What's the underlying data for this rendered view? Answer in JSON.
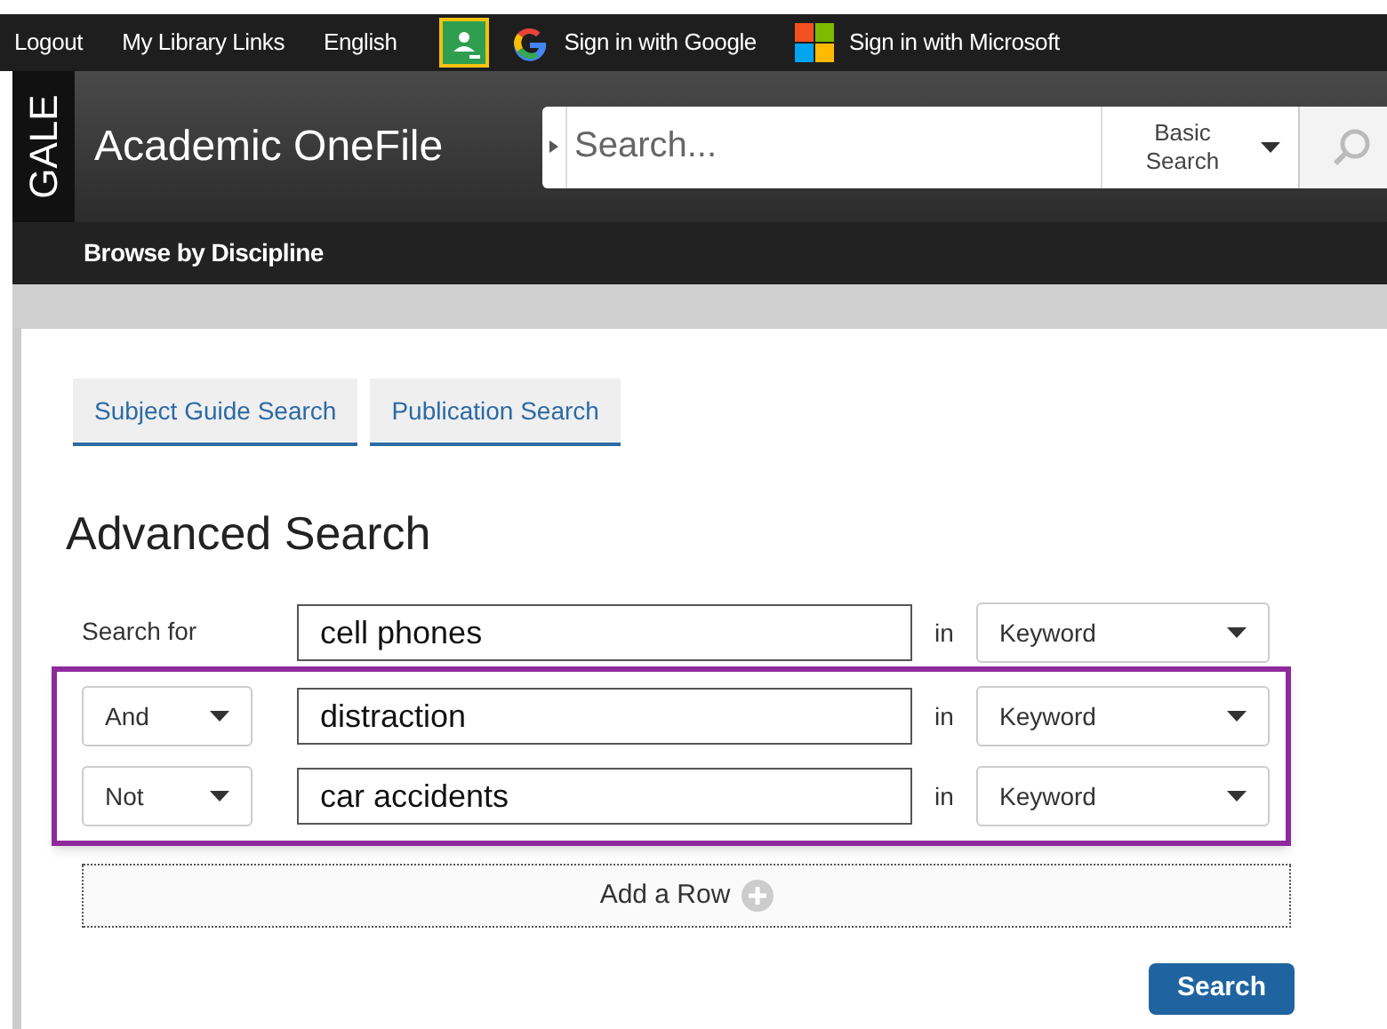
{
  "top_bar": {
    "links": [
      "Logout",
      "My Library Links",
      "English"
    ],
    "sign_in": [
      {
        "kind": "google",
        "label": "Sign in with Google"
      },
      {
        "kind": "microsoft",
        "label": "Sign in with Microsoft"
      }
    ]
  },
  "header": {
    "logo": "GALE",
    "title": "Academic OneFile",
    "search": {
      "placeholder": "Search...",
      "mode": "Basic Search"
    }
  },
  "nav": [
    "Browse by Discipline"
  ],
  "tabs": [
    {
      "label": "Subject Guide Search",
      "selected": false
    },
    {
      "label": "Publication Search",
      "selected": false
    }
  ],
  "heading": "Advanced Search",
  "rows": [
    {
      "kind": "label",
      "label": "Search for",
      "value": "cell phones",
      "in": "in",
      "field": "Keyword",
      "highlighted": false
    },
    {
      "kind": "operator",
      "label": "And",
      "value": "distraction",
      "in": "in",
      "field": "Keyword",
      "highlighted": true
    },
    {
      "kind": "operator",
      "label": "Not",
      "value": "car accidents",
      "in": "in",
      "field": "Keyword",
      "highlighted": true
    }
  ],
  "add_row": "Add a Row",
  "submit": "Search"
}
